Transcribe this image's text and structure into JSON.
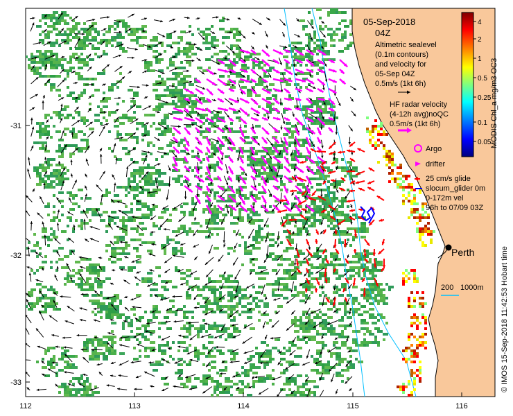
{
  "map": {
    "date": "05-Sep-2018",
    "hour": "04Z",
    "altimetry_caption": [
      "Altimetric sealevel",
      "(0.1m contours)",
      "and velocity for",
      "05-Sep 04Z",
      "0.5m/s (1kt 6h)"
    ],
    "hf_radar_caption": [
      "HF radar velocity",
      "(4-12h avg)noQC",
      "0.5m/s (1kt 6h)"
    ],
    "argo_label": "Argo",
    "drifter_label": "drifter",
    "glider_caption": [
      "25 cm/s glide",
      "slocum_glider 0m",
      "0-172m vel",
      "96h to 07/09 03Z"
    ],
    "city": "Perth",
    "isobath_labels": [
      "200",
      "1000m"
    ],
    "side_text": "© IMOS 15-Sep-2018 11:42:53 Hobart time",
    "x_ticks": [
      "112",
      "113",
      "114",
      "115",
      "116"
    ],
    "y_ticks": [
      "-31",
      "-32",
      "-33"
    ],
    "colorbar": {
      "label": "MODIS Chl_a mg/m3 OC3",
      "ticks": [
        "4",
        "2",
        "1",
        "0.5",
        "0.25",
        "0.1",
        "0.05"
      ],
      "colors": [
        "#00007f",
        "#0000ff",
        "#007fff",
        "#00ffff",
        "#7fff7f",
        "#ffff00",
        "#ff7f00",
        "#ff0000",
        "#7f0000"
      ]
    },
    "colors": {
      "land": "#f9c89b",
      "chl_green": "#3aa84a",
      "hf_vector": "#ff00ff",
      "glider_vector": "#ff0000",
      "glider_track": "#0000ff",
      "isobath": "#00bfff"
    }
  }
}
